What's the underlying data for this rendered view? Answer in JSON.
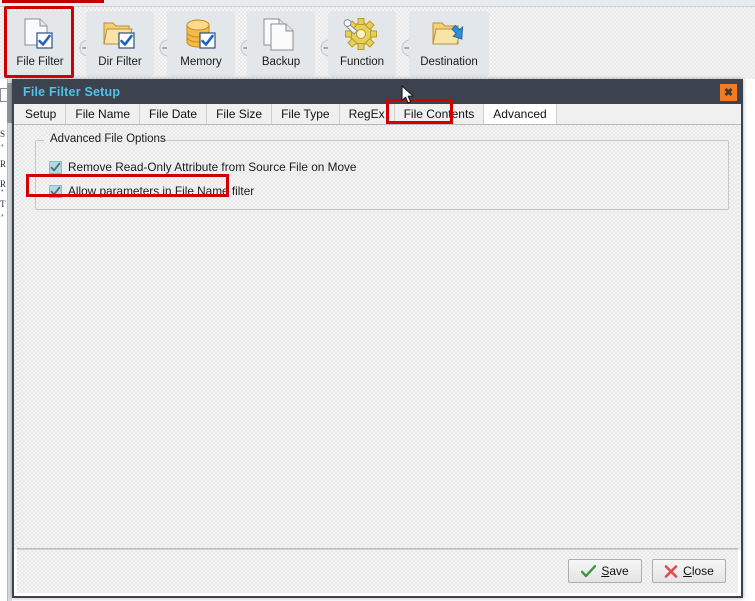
{
  "app": {
    "toolbar": {
      "steps": [
        {
          "label": "File Filter",
          "icon": "document-check-icon",
          "selected": true
        },
        {
          "label": "Dir Filter",
          "icon": "folder-check-icon",
          "selected": false
        },
        {
          "label": "Memory",
          "icon": "database-check-icon",
          "selected": false
        },
        {
          "label": "Backup",
          "icon": "copy-documents-icon",
          "selected": false
        },
        {
          "label": "Function",
          "icon": "gear-wrench-icon",
          "selected": false
        },
        {
          "label": "Destination",
          "icon": "folder-arrow-icon",
          "selected": false
        }
      ],
      "separator_icon": "arrow-right-icon"
    },
    "background_list": {
      "chars": [
        "S",
        "R",
        "R",
        "T"
      ],
      "markers": [
        "*",
        "*",
        "*"
      ]
    }
  },
  "dialog": {
    "title": "File Filter Setup",
    "close_button": {
      "name": "window-close-button",
      "glyph": "✖"
    },
    "tabs": [
      {
        "label": "Setup",
        "active": false
      },
      {
        "label": "File Name",
        "active": false
      },
      {
        "label": "File Date",
        "active": false
      },
      {
        "label": "File Size",
        "active": false
      },
      {
        "label": "File Type",
        "active": false
      },
      {
        "label": "RegEx",
        "active": false
      },
      {
        "label": "File Contents",
        "active": false
      },
      {
        "label": "Advanced",
        "active": true
      }
    ],
    "advanced": {
      "group_title": "Advanced File Options",
      "options": [
        {
          "label": "Remove Read-Only Attribute from Source File on Move",
          "checked": true
        },
        {
          "label": "Allow parameters in File Name filter",
          "checked": true
        }
      ]
    },
    "footer": {
      "save": {
        "pre": "",
        "accel": "S",
        "post": "ave",
        "icon": "green-check-icon"
      },
      "close": {
        "pre": "",
        "accel": "C",
        "post": "lose",
        "icon": "red-x-icon"
      }
    }
  },
  "annotations": {
    "highlights": [
      {
        "name": "file-filter-step-highlight",
        "color": "#d00000"
      },
      {
        "name": "advanced-tab-highlight",
        "color": "#d00000"
      },
      {
        "name": "allow-parameters-highlight",
        "color": "#d00000"
      }
    ]
  },
  "colors": {
    "titlebar": "#3c424e",
    "title_text": "#4ec3e8",
    "close_button": "#f57a20",
    "highlight": "#d00000",
    "checkbox": "#aadbe6"
  }
}
